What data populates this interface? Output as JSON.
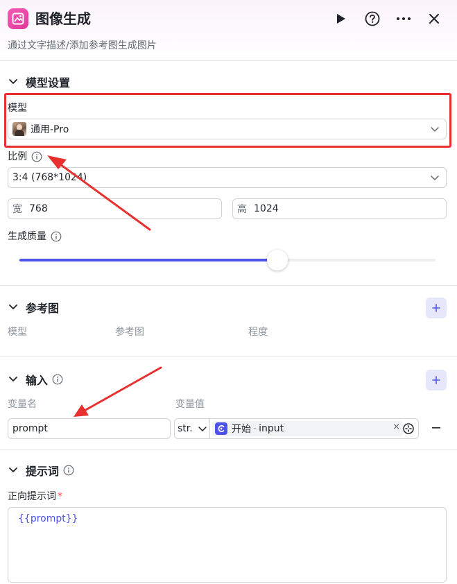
{
  "header": {
    "title": "图像生成",
    "subtitle": "通过文字描述/添加参考图生成图片",
    "brand_color": "#e0399b"
  },
  "model_settings": {
    "section_title": "模型设置",
    "model_label": "模型",
    "model_value": "通用-Pro",
    "ratio_label": "比例",
    "ratio_value": "3:4 (768*1024)",
    "width_prefix": "宽",
    "width_value": "768",
    "height_prefix": "高",
    "height_value": "1024",
    "quality_label": "生成质量",
    "quality_level": 0.62
  },
  "reference": {
    "section_title": "参考图",
    "columns": [
      "模型",
      "参考图",
      "程度"
    ]
  },
  "input": {
    "section_title": "输入",
    "col_name": "变量名",
    "col_value": "变量值",
    "rows": [
      {
        "name": "prompt",
        "type": "str.",
        "node": "开始",
        "sep": "-",
        "var": "input",
        "clear": "×"
      }
    ]
  },
  "prompt": {
    "section_title": "提示词",
    "positive_label": "正向提示词",
    "required_mark": "*",
    "positive_value": "{{prompt}}"
  },
  "accent_color": "#4d53e8",
  "annotation_color": "#e8312f"
}
